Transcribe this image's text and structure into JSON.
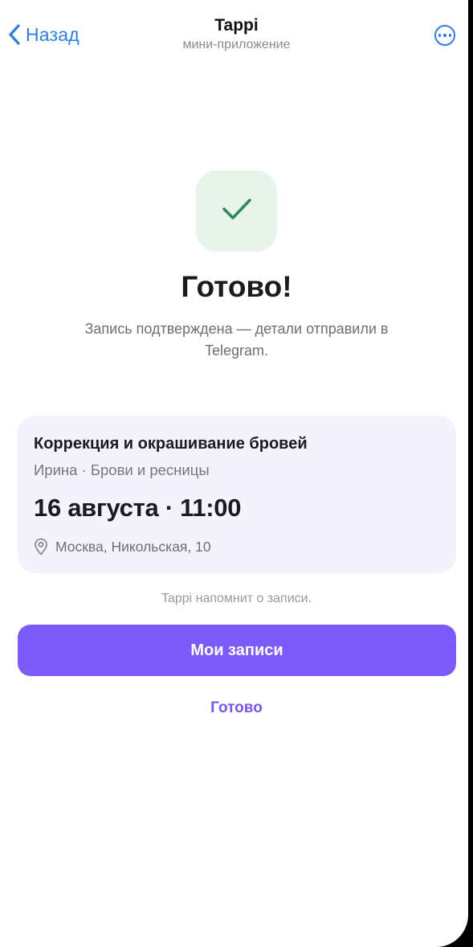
{
  "nav": {
    "back_label": "Назад",
    "title": "Tappi",
    "subtitle": "мини-приложение",
    "back_icon": "chevron-left-icon",
    "more_icon": "more-horizontal-icon"
  },
  "success": {
    "icon": "checkmark-icon",
    "headline": "Готово!",
    "description": "Запись подтверждена — детали отправили в Telegram."
  },
  "booking": {
    "service": "Коррекция и окрашивание бровей",
    "specialist": "Ирина · Брови и ресницы",
    "datetime": "16 августа · 11:00",
    "address_icon": "location-pin-icon",
    "address": "Москва, Никольская, 10"
  },
  "footer": {
    "reminder": "Tappi напомнит о записи.",
    "primary_button": "Мои записи",
    "secondary_button": "Готово"
  },
  "colors": {
    "accent": "#7b5cf8",
    "link": "#2f7fe0",
    "success_bg": "#e6f4ea",
    "success_check": "#2f8a57",
    "card_bg": "#f4f2fd"
  }
}
